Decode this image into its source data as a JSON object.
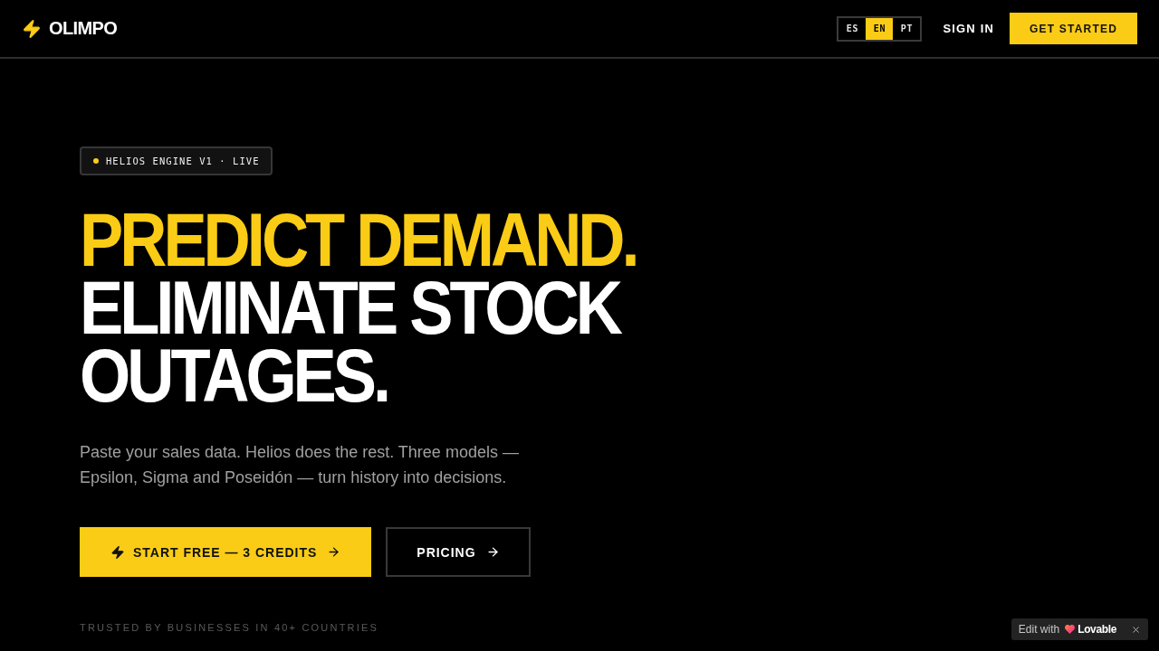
{
  "header": {
    "logo": "OLIMPO",
    "languages": [
      {
        "label": "ES",
        "selected": false
      },
      {
        "label": "EN",
        "selected": true
      },
      {
        "label": "PT",
        "selected": false
      }
    ],
    "sign_in": "SIGN IN",
    "cta": "GET STARTED"
  },
  "hero": {
    "badge": "HELIOS ENGINE V1 · LIVE",
    "headline_accent": "PREDICT DEMAND.",
    "headline": "ELIMINATE STOCK OUTAGES.",
    "description": "Paste your sales data. Helios does the rest. Three models — Epsilon, Sigma and Poseidón — turn history into decisions.",
    "buttons": [
      {
        "label": "START FREE — 3 CREDITS",
        "kind": "primary"
      },
      {
        "label": "PRICING",
        "kind": "secondary"
      }
    ],
    "trust_note": "TRUSTED BY BUSINESSES IN 40+ COUNTRIES"
  },
  "edit_badge": {
    "prefix": "Edit with",
    "brand": "Lovable"
  }
}
